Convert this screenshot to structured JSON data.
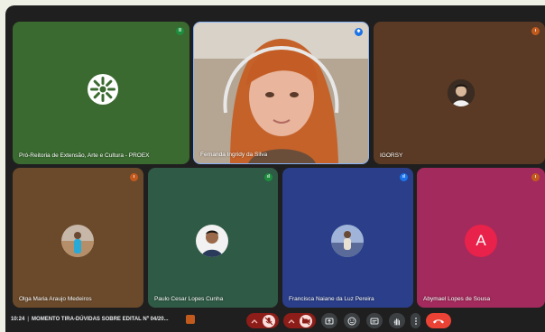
{
  "participants": {
    "proex": {
      "name": "Pró-Reitoria de Extensão, Arte e Cultura - PROEX",
      "badge": "Il"
    },
    "fernanda": {
      "name": "Fernanda Ingridy da Silva"
    },
    "igorsy": {
      "name": "IGORSY"
    },
    "olga": {
      "name": "Olga Maria Araujo Medeiros"
    },
    "paulo": {
      "name": "Paulo Cesar Lopes Cunha"
    },
    "francisca": {
      "name": "Francisca Naiane da Luz Pereira"
    },
    "abymael": {
      "name": "Abymael Lopes de Sousa",
      "initial": "A"
    }
  },
  "meeting": {
    "time": "10:24",
    "title": "MOMENTO TIRA-DÚVIDAS SOBRE EDITAL Nº 04/20..."
  },
  "icons": [
    "microphone-off-icon",
    "camera-off-icon",
    "present-screen-icon",
    "emoji-icon",
    "captions-icon",
    "raise-hand-icon",
    "more-options-icon",
    "leave-call-icon"
  ],
  "colors": {
    "leave": "#ea4335",
    "muted": "#8c1d18",
    "abymael_avatar": "#e8224a"
  }
}
